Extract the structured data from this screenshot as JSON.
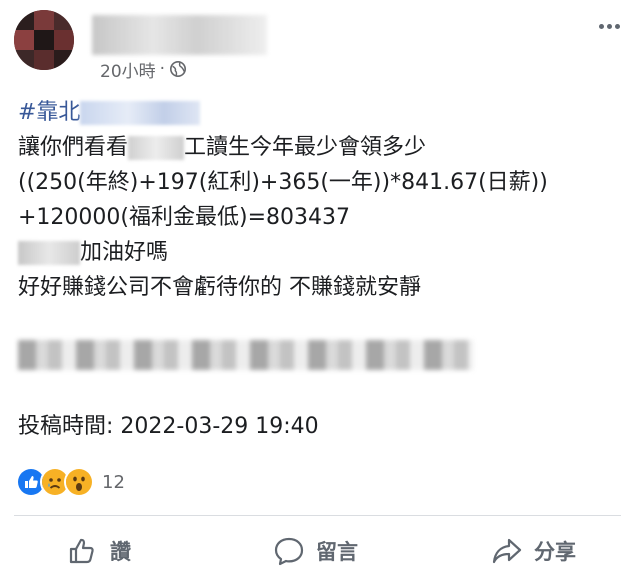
{
  "header": {
    "time": "20小時",
    "separator": "·"
  },
  "body": {
    "hashtag": "#靠北",
    "line2_start": "讓你們看看",
    "line2_end": "工讀生今年最少會領多少",
    "line3": "((250(年終)+197(紅利)+365(一年))*841.67(日薪))",
    "line4": "+120000(福利金最低)=803437",
    "line5_end": "加油好嗎",
    "line6": "好好賺錢公司不會虧待你的   不賺錢就安靜",
    "post_time": "投稿時間: 2022-03-29 19:40"
  },
  "reactions": {
    "icons": [
      "like-icon",
      "sad-icon",
      "wow-icon"
    ],
    "count": "12"
  },
  "actions": {
    "like": "讚",
    "comment": "留言",
    "share": "分享"
  },
  "colors": {
    "hashtag": "#385898",
    "meta": "#65676b",
    "like_blue": "#1877f2",
    "reaction_yellow": "#f7b125"
  }
}
